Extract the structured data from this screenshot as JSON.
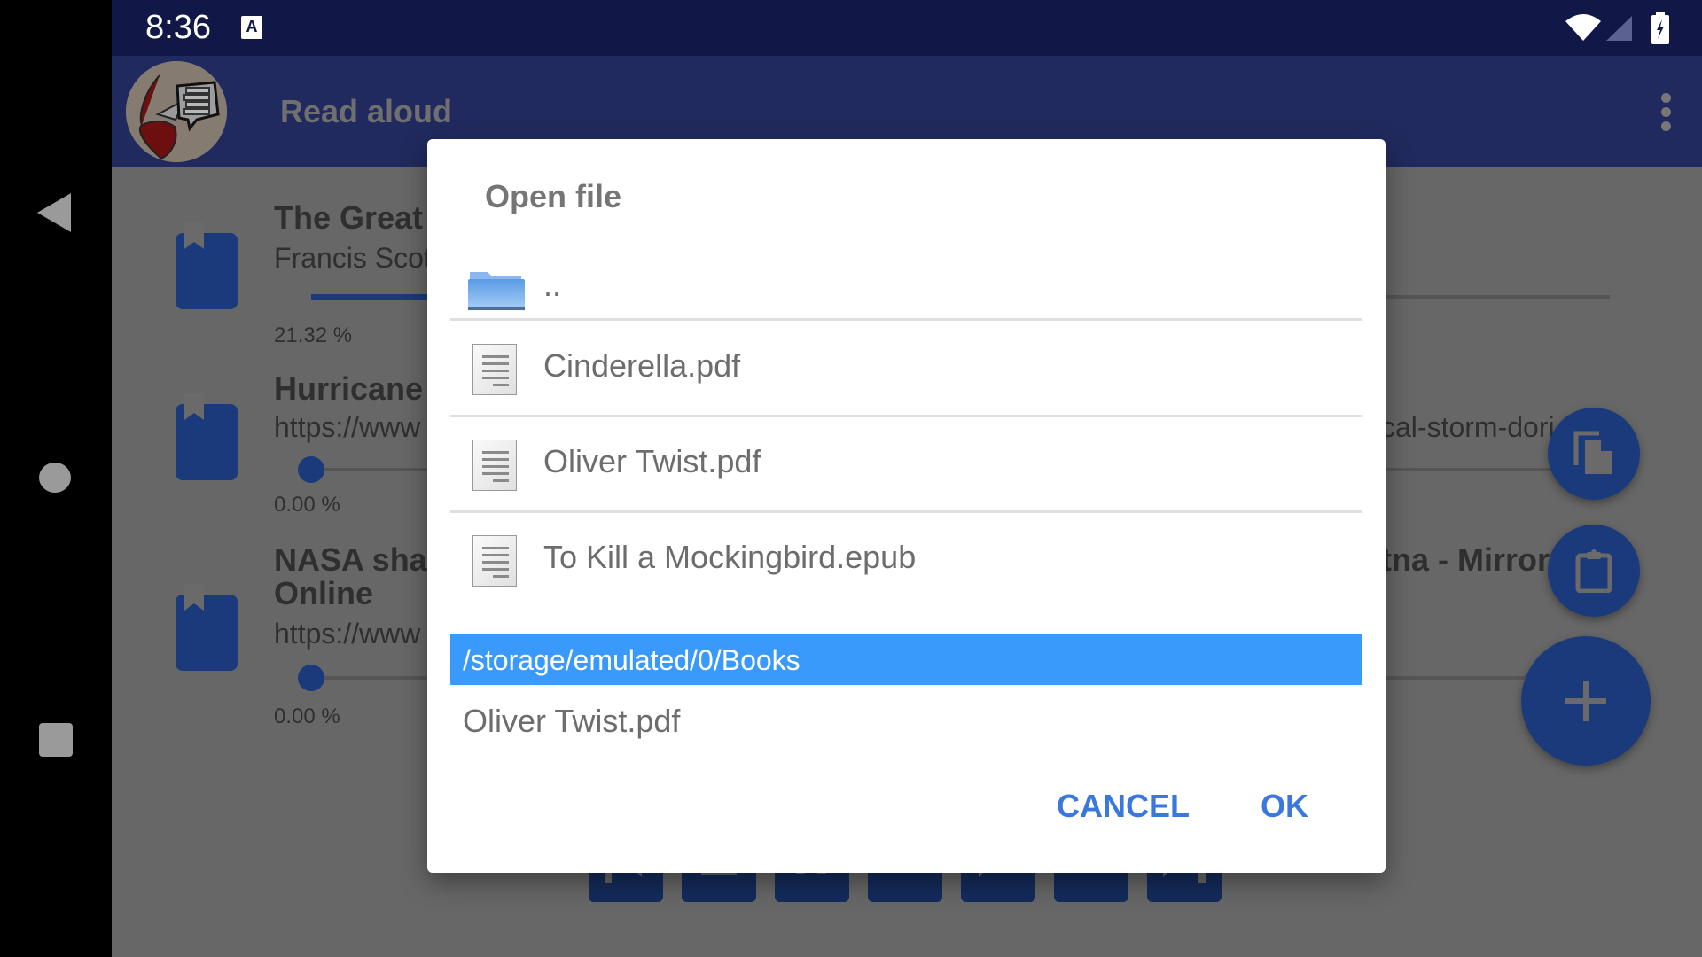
{
  "status_bar": {
    "time": "8:36",
    "notification_icon": "A",
    "icons": [
      "wifi-icon",
      "cell-signal-icon",
      "battery-charging-icon"
    ]
  },
  "nav_bar": {
    "buttons": [
      "back",
      "home",
      "recents"
    ]
  },
  "app_bar": {
    "title": "Read aloud",
    "menu_icon": "more-vert-icon"
  },
  "documents": [
    {
      "title": "The Great",
      "subtitle": "Francis Scot",
      "progress_label": "21.32 %",
      "progress_percent": 21.32
    },
    {
      "title": "Hurricane",
      "subtitle": "https://www",
      "subtitle_right": "cal-storm-dori",
      "progress_label": "0.00 %",
      "progress_percent": 0
    },
    {
      "title": "NASA shar",
      "title_line2": "Online",
      "title_right": "tna - Mirror",
      "subtitle": "https://www",
      "progress_label": "0.00 %",
      "progress_percent": 0
    }
  ],
  "fabs": [
    {
      "name": "open-file",
      "icon": "file-copy-icon"
    },
    {
      "name": "paste-clipboard",
      "icon": "clipboard-icon"
    },
    {
      "name": "add",
      "icon": "plus-icon",
      "label": "+"
    }
  ],
  "player_controls": [
    "skip-previous",
    "stop",
    "pause",
    "rewind",
    "play",
    "fast-forward",
    "skip-next"
  ],
  "dialog": {
    "title": "Open file",
    "parent_label": "..",
    "files": [
      {
        "name": "Cinderella.pdf"
      },
      {
        "name": "Oliver Twist.pdf"
      },
      {
        "name": "To Kill a Mockingbird.epub"
      }
    ],
    "current_path": "/storage/emulated/0/Books",
    "selected_file": "Oliver Twist.pdf",
    "cancel_label": "CANCEL",
    "ok_label": "OK",
    "accent_color": "#3b78de",
    "path_bar_color": "#3a9afc"
  }
}
